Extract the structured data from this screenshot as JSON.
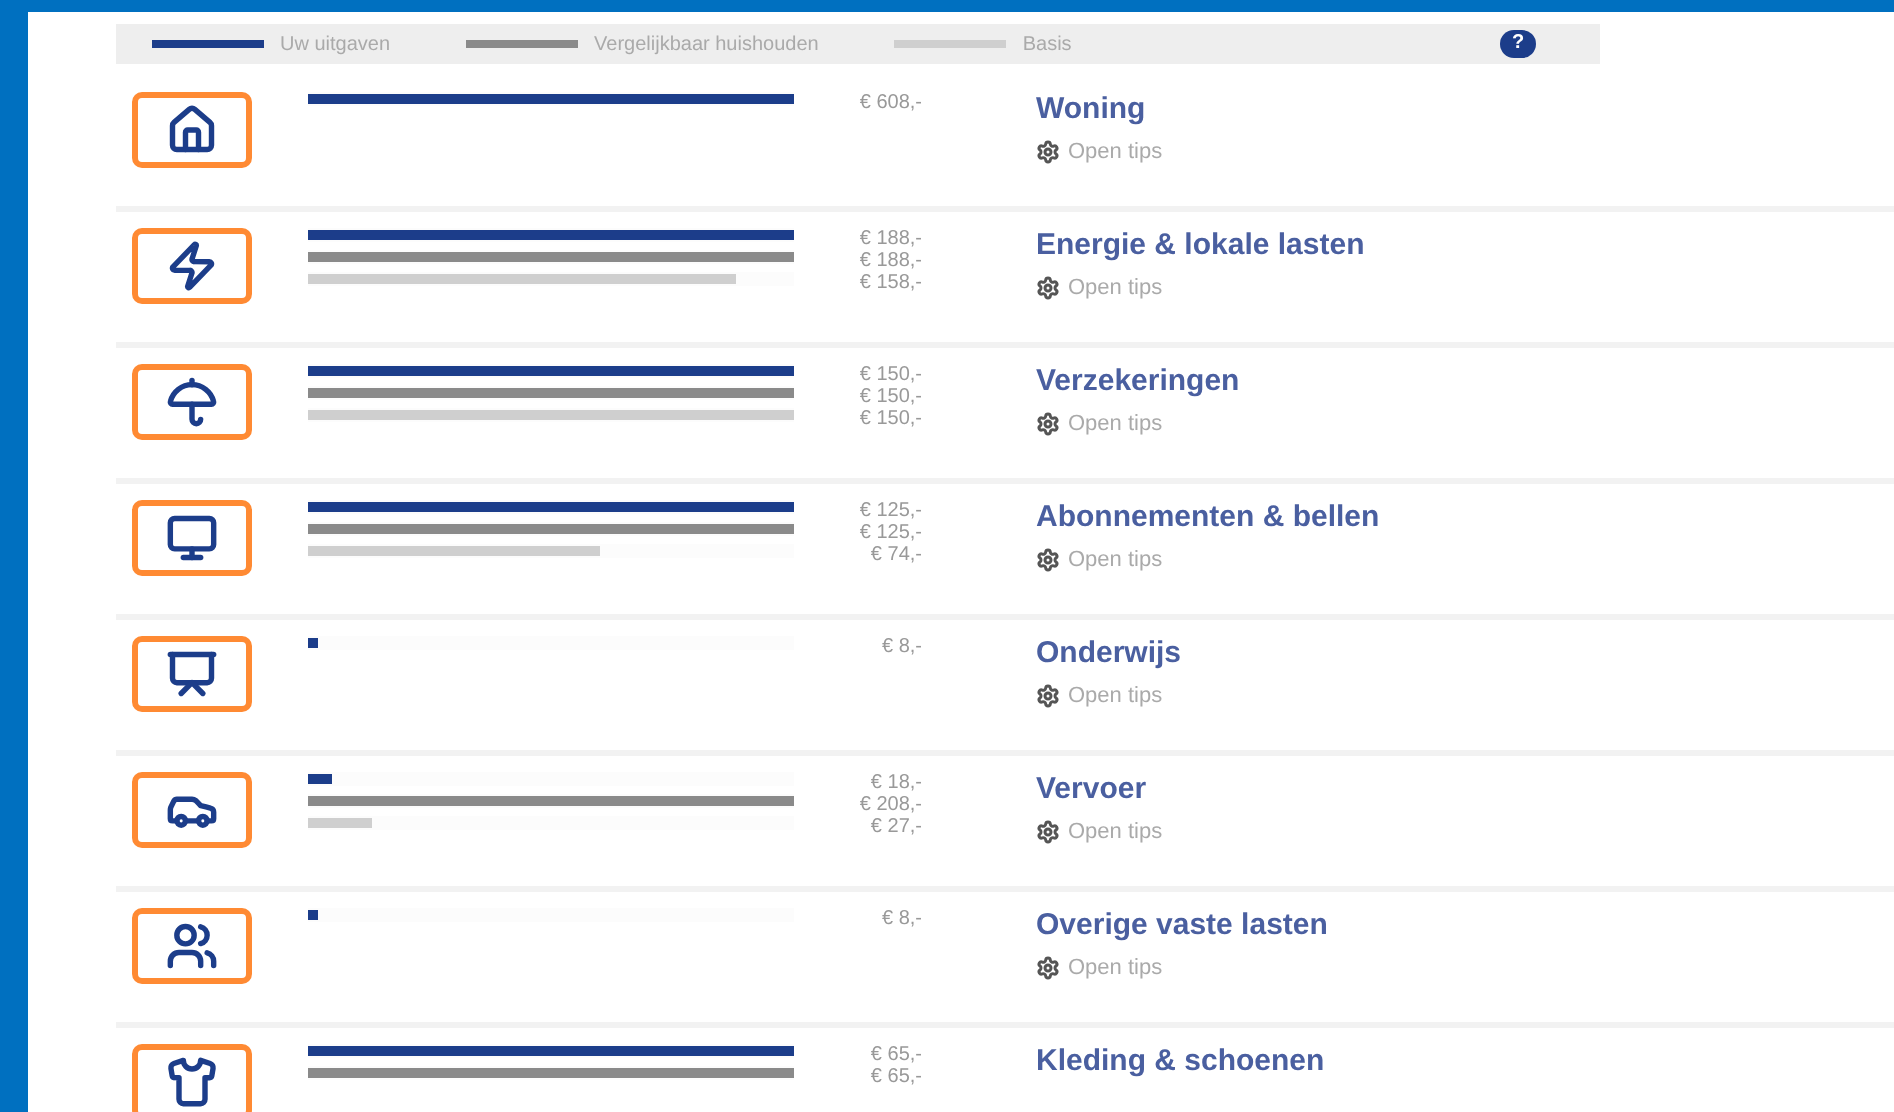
{
  "legend": [
    {
      "kind": "own",
      "label": "Uw uitgaven"
    },
    {
      "kind": "compare",
      "label": "Vergelijkbaar huishouden"
    },
    {
      "kind": "basis",
      "label": "Basis"
    }
  ],
  "help": "?",
  "categories": [
    {
      "title": "Woning",
      "tips": "Open tips",
      "bars": [
        {
          "kind": "own",
          "level": 1,
          "amount": "€ 608,-"
        }
      ]
    },
    {
      "title": "Energie & lokale lasten",
      "tips": "Open tips",
      "bars": [
        {
          "kind": "own",
          "level": 1,
          "amount": "€ 188,-"
        },
        {
          "kind": "compare",
          "level": 1,
          "amount": "€ 188,-"
        },
        {
          "kind": "basis",
          "level": 0.88,
          "amount": "€ 158,-"
        }
      ]
    },
    {
      "title": "Verzekeringen",
      "tips": "Open tips",
      "bars": [
        {
          "kind": "own",
          "level": 1,
          "amount": "€ 150,-"
        },
        {
          "kind": "compare",
          "level": 1,
          "amount": "€ 150,-"
        },
        {
          "kind": "basis",
          "level": 1,
          "amount": "€ 150,-"
        }
      ]
    },
    {
      "title": "Abonnementen & bellen",
      "tips": "Open tips",
      "bars": [
        {
          "kind": "own",
          "level": 1,
          "amount": "€ 125,-"
        },
        {
          "kind": "compare",
          "level": 1,
          "amount": "€ 125,-"
        },
        {
          "kind": "basis",
          "level": 0.6,
          "amount": "€ 74,-"
        }
      ]
    },
    {
      "title": "Onderwijs",
      "tips": "Open tips",
      "bars": [
        {
          "kind": "own",
          "level": 0.02,
          "amount": "€ 8,-"
        }
      ]
    },
    {
      "title": "Vervoer",
      "tips": "Open tips",
      "bars": [
        {
          "kind": "own",
          "level": 0.05,
          "amount": "€ 18,-"
        },
        {
          "kind": "compare",
          "level": 1,
          "amount": "€ 208,-"
        },
        {
          "kind": "basis",
          "level": 0.13,
          "amount": "€ 27,-"
        }
      ]
    },
    {
      "title": "Overige vaste lasten",
      "tips": "Open tips",
      "bars": [
        {
          "kind": "own",
          "level": 0.02,
          "amount": "€ 8,-"
        }
      ]
    },
    {
      "title": "Kleding & schoenen",
      "bars": [
        {
          "kind": "own",
          "level": 1,
          "amount": "€ 65,-"
        },
        {
          "kind": "compare",
          "level": 1,
          "amount": "€ 65,-"
        }
      ]
    }
  ]
}
